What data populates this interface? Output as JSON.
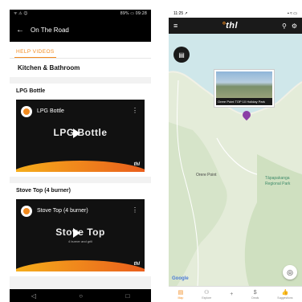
{
  "left": {
    "status": {
      "left": "ᯤ ⚠ ☺",
      "right": "89% ▭ 09:28"
    },
    "header": {
      "back_icon": "←",
      "title": "On The Road"
    },
    "tab": "HELP VIDEOS",
    "section": "Kitchen & Bathroom",
    "cards": [
      {
        "title": "LPG Bottle",
        "video_title": "LPG Bottle",
        "big_text": "LPG Bottle",
        "sub_text": ""
      },
      {
        "title": "Stove Top (4 burner)",
        "video_title": "Stove Top (4 burner)",
        "big_text": "Stove Top",
        "sub_text": "4 burner and grill"
      }
    ],
    "brand_mark": "thl",
    "nav": [
      "◁",
      "○",
      "□"
    ]
  },
  "right": {
    "status": {
      "time": "11:25 ↗",
      "icons": "▪ ≈ ▭"
    },
    "header": {
      "menu_icon": "≡",
      "brand": "thl",
      "brand_mark": "°",
      "search_icon": "⚲",
      "settings_icon": "⚙"
    },
    "map": {
      "labels": {
        "orere_point": "Orere Point",
        "tapapakanga": "Tāpapakanga",
        "regional_park": "Regional Park"
      },
      "popup_caption": "Orere Point TOP 10 Holiday Park",
      "google": "Google"
    },
    "nav": [
      {
        "label": "Map",
        "icon": "▤",
        "active": true
      },
      {
        "label": "Explore",
        "icon": "⚇",
        "active": false
      },
      {
        "label": "",
        "icon": "+",
        "active": false
      },
      {
        "label": "Deals",
        "icon": "$",
        "active": false
      },
      {
        "label": "Suggestions",
        "icon": "👍",
        "active": false
      }
    ]
  }
}
